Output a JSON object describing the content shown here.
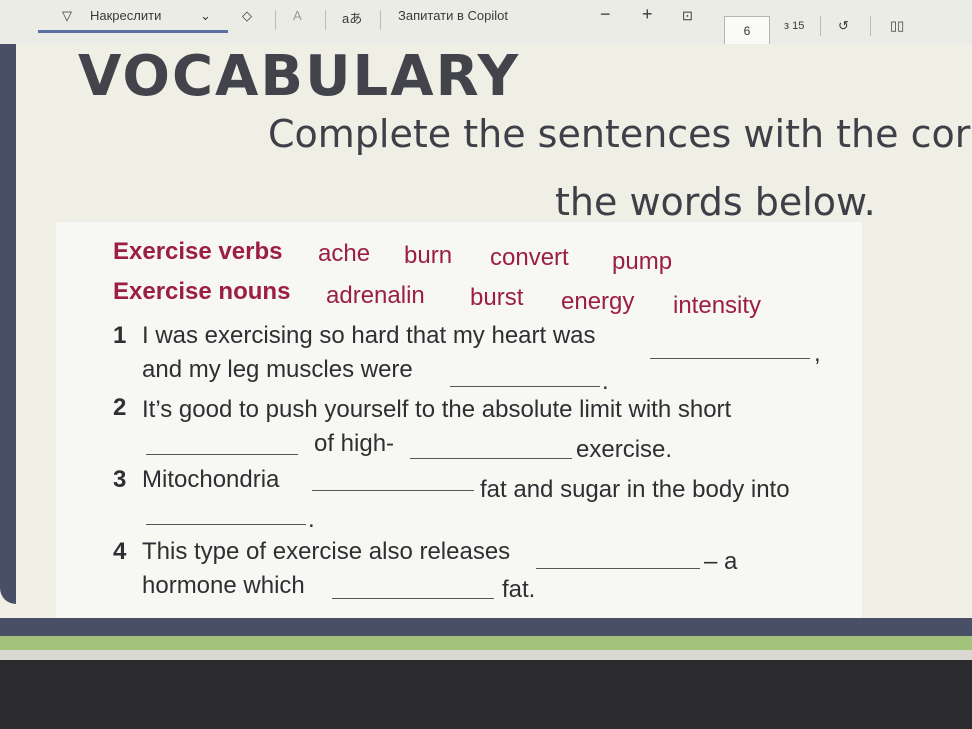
{
  "toolbar": {
    "draw_label": "Накреслити",
    "copilot_label": "Запитати в Copilot",
    "minus": "−",
    "plus": "+",
    "page_current": "6",
    "page_total": "з 15",
    "aa_label": "aあ",
    "text_icon_label": "A"
  },
  "page": {
    "title": "VOCABULARY",
    "instruction_line1": "Complete the sentences with the corre",
    "instruction_line2": "the words below.",
    "verbs_label": "Exercise verbs",
    "verbs": [
      "ache",
      "burn",
      "convert",
      "pump"
    ],
    "nouns_label": "Exercise nouns",
    "nouns": [
      "adrenalin",
      "burst",
      "energy",
      "intensity"
    ],
    "items": [
      {
        "num": "1",
        "parts": [
          "I was exercising so hard that my heart was",
          ",",
          "and my leg muscles were",
          "."
        ]
      },
      {
        "num": "2",
        "parts": [
          "It’s good to push yourself to the absolute limit with short",
          "of high-",
          "exercise."
        ]
      },
      {
        "num": "3",
        "parts": [
          "Mitochondria",
          "fat and sugar in the body into",
          "."
        ]
      },
      {
        "num": "4",
        "parts": [
          "This type of exercise also releases",
          "– a",
          "hormone which",
          "fat."
        ]
      }
    ]
  }
}
